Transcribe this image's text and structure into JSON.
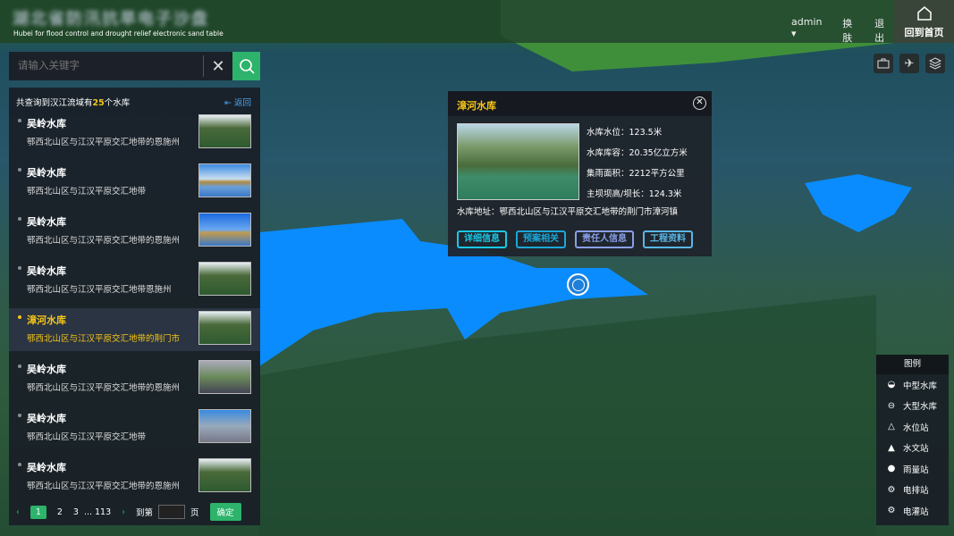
{
  "header": {
    "title_blurred": "湖北省防汛抗旱电子沙盘",
    "subtitle": "Hubei for flood control and drought relief electronic sand table",
    "user": "admin ▾",
    "skin": "换肤",
    "logout": "退出",
    "home": "回到首页"
  },
  "tools": [
    "briefcase-icon",
    "plane-icon",
    "layers-icon"
  ],
  "search": {
    "placeholder": "请输入关键字",
    "clear": "✕"
  },
  "list": {
    "summary_pre": "共查询到汉江流域有",
    "count": "25",
    "summary_post": "个水库",
    "back": "返回",
    "items": [
      {
        "name": "吴岭水库",
        "addr": "鄂西北山区与江汉平原交汇地带的恩施州",
        "active": false
      },
      {
        "name": "吴岭水库",
        "addr": "鄂西北山区与江汉平原交汇地带",
        "active": false
      },
      {
        "name": "吴岭水库",
        "addr": "鄂西北山区与江汉平原交汇地带的恩施州",
        "active": false
      },
      {
        "name": "吴岭水库",
        "addr": "鄂西北山区与江汉平原交汇地带恩施州",
        "active": false
      },
      {
        "name": "漳河水库",
        "addr": "鄂西北山区与江汉平原交汇地带的荆门市",
        "active": true
      },
      {
        "name": "吴岭水库",
        "addr": "鄂西北山区与江汉平原交汇地带的恩施州",
        "active": false
      },
      {
        "name": "吴岭水库",
        "addr": "鄂西北山区与江汉平原交汇地带",
        "active": false
      },
      {
        "name": "吴岭水库",
        "addr": "鄂西北山区与江汉平原交汇地带的恩施州",
        "active": false
      }
    ]
  },
  "pager": {
    "prev": "‹",
    "current": "1",
    "p2": "2",
    "p3": "3",
    "ellipsis": "...",
    "last": "113",
    "next": "›",
    "goto": "到第",
    "page": "页",
    "confirm": "确定"
  },
  "popup": {
    "title": "漳河水库",
    "close": "✕",
    "level": "水库水位：123.5米",
    "capacity": "水库库容：20.35亿立方米",
    "area": "集雨面积：2212平方公里",
    "dam": "主坝坝高/坝长：124.3米",
    "address": "水库地址：鄂西北山区与江汉平原交汇地带的荆门市漳河镇",
    "buttons": [
      {
        "label": "详细信息",
        "color": "#19c8e6"
      },
      {
        "label": "预案相关",
        "color": "#1aa8d8"
      },
      {
        "label": "责任人信息",
        "color": "#8a9ee8"
      },
      {
        "label": "工程资料",
        "color": "#5ab6e6"
      }
    ]
  },
  "legend": {
    "title": "图例",
    "items": [
      {
        "icon": "◒",
        "label": "中型水库"
      },
      {
        "icon": "⊖",
        "label": "大型水库"
      },
      {
        "icon": "△",
        "label": "水位站"
      },
      {
        "icon": "▲",
        "label": "水文站"
      },
      {
        "icon": "●",
        "label": "雨量站"
      },
      {
        "icon": "⚙",
        "label": "电排站"
      },
      {
        "icon": "⚙",
        "label": "电灌站"
      }
    ]
  }
}
